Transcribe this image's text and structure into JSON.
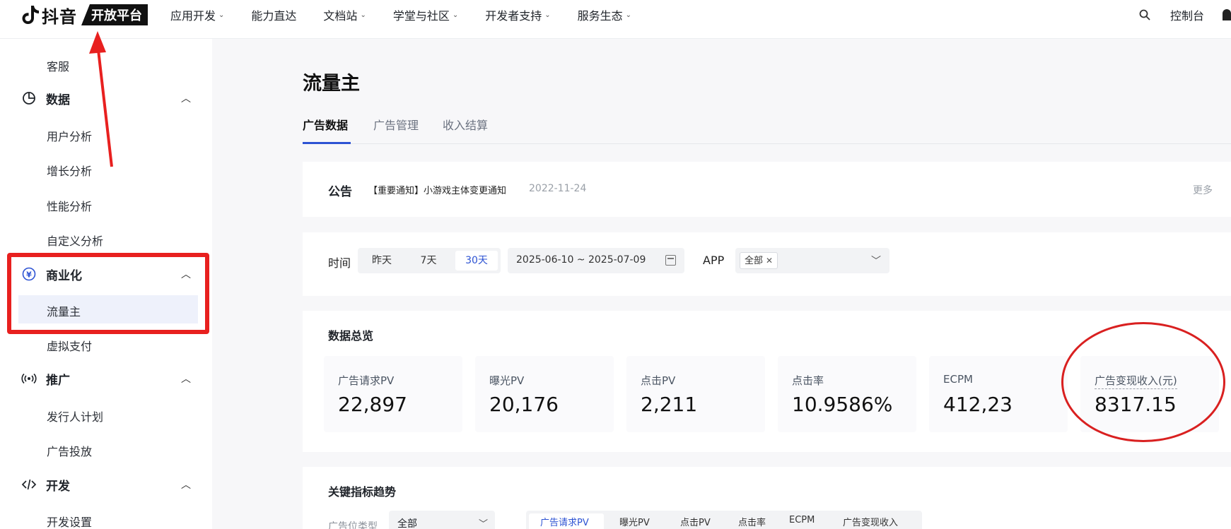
{
  "header": {
    "brand": "抖音",
    "brand_tag": "开放平台",
    "nav": [
      {
        "label": "应用开发",
        "caret": true
      },
      {
        "label": "能力直达",
        "caret": false
      },
      {
        "label": "文档站",
        "caret": true
      },
      {
        "label": "学堂与社区",
        "caret": true
      },
      {
        "label": "开发者支持",
        "caret": true
      },
      {
        "label": "服务生态",
        "caret": true
      }
    ],
    "console": "控制台"
  },
  "sidebar": {
    "items": [
      {
        "label": "客服"
      },
      {
        "label": "数据",
        "group": true,
        "icon": "pie-chart-icon"
      },
      {
        "label": "用户分析"
      },
      {
        "label": "增长分析"
      },
      {
        "label": "性能分析"
      },
      {
        "label": "自定义分析"
      },
      {
        "label": "商业化",
        "group": true,
        "icon": "yuan-icon"
      },
      {
        "label": "流量主",
        "active": true
      },
      {
        "label": "虚拟支付"
      },
      {
        "label": "推广",
        "group": true,
        "icon": "broadcast-icon"
      },
      {
        "label": "发行人计划"
      },
      {
        "label": "广告投放"
      },
      {
        "label": "开发",
        "group": true,
        "icon": "code-icon"
      },
      {
        "label": "开发设置"
      }
    ]
  },
  "main": {
    "title": "流量主",
    "tabs": [
      "广告数据",
      "广告管理",
      "收入结算"
    ],
    "notice": {
      "label": "公告",
      "text": "【重要通知】小游戏主体变更通知",
      "date": "2022-11-24",
      "more": "更多"
    },
    "filters": {
      "time_label": "时间",
      "ranges": [
        "昨天",
        "7天",
        "30天"
      ],
      "date_range": "2025-06-10 ~ 2025-07-09",
      "app_label": "APP",
      "app_value": "全部"
    },
    "overview": {
      "title": "数据总览",
      "metrics": [
        {
          "label": "广告请求PV",
          "value": "22,897"
        },
        {
          "label": "曝光PV",
          "value": "20,176"
        },
        {
          "label": "点击PV",
          "value": "2,211"
        },
        {
          "label": "点击率",
          "value": "10.9586%"
        },
        {
          "label": "ECPM",
          "value": "412,23"
        },
        {
          "label": "广告变现收入(元)",
          "value": "8317.15"
        }
      ]
    },
    "trend": {
      "title": "关键指标趋势",
      "filter_label": "广告位类型",
      "filter_value": "全部",
      "metric_tabs": [
        "广告请求PV",
        "曝光PV",
        "点击PV",
        "点击率",
        "ECPM",
        "广告变现收入"
      ]
    }
  },
  "colors": {
    "accent": "#2d53d3",
    "annotation": "#e8201f"
  }
}
